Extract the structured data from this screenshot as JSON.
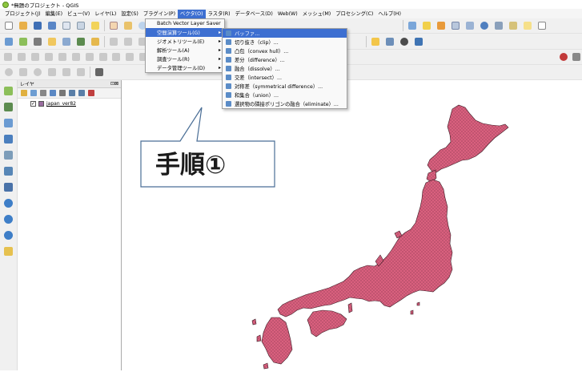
{
  "window": {
    "title": "*無題のプロジェクト - QGIS"
  },
  "menubar": {
    "items": [
      {
        "label": "プロジェクト(J)"
      },
      {
        "label": "編集(E)"
      },
      {
        "label": "ビュー(V)"
      },
      {
        "label": "レイヤ(L)"
      },
      {
        "label": "設定(S)"
      },
      {
        "label": "プラグイン(P)"
      },
      {
        "label": "ベクタ(O)"
      },
      {
        "label": "ラスタ(R)"
      },
      {
        "label": "データベース(D)"
      },
      {
        "label": "Web(W)"
      },
      {
        "label": "メッシュ(M)"
      },
      {
        "label": "プロセシング(C)"
      },
      {
        "label": "ヘルプ(H)"
      }
    ]
  },
  "vector_menu": {
    "items": [
      {
        "label": "Batch Vector Layer Saver",
        "submenu": false
      },
      {
        "label": "空間演算ツール(G)",
        "submenu": true
      },
      {
        "label": "ジオメトリツール(E)",
        "submenu": true
      },
      {
        "label": "解析ツール(A)",
        "submenu": true
      },
      {
        "label": "調査ツール(R)",
        "submenu": true
      },
      {
        "label": "データ管理ツール(D)",
        "submenu": true
      }
    ]
  },
  "geoprocessing_menu": {
    "items": [
      {
        "label": "バッファ..."
      },
      {
        "label": "切り抜き（clip）..."
      },
      {
        "label": "凸包（convex hull）..."
      },
      {
        "label": "差分（difference）..."
      },
      {
        "label": "融合（dissolve）..."
      },
      {
        "label": "交差（intersect）..."
      },
      {
        "label": "対称差（symmetrical difference）..."
      },
      {
        "label": "和集合（union）..."
      },
      {
        "label": "選択物の隣接ポリゴンの融合（eliminate）..."
      }
    ]
  },
  "layers_panel": {
    "title": "レイヤ",
    "close_glyph": "⊡⊠",
    "layers": [
      {
        "name": "japan_ver82",
        "checked": true,
        "check_glyph": "✓",
        "color": "#9a6c9f"
      }
    ]
  },
  "callout": {
    "text": "手順①"
  },
  "colors": {
    "map_fill": "#d9607e",
    "map_stroke": "#3c1a24",
    "menu_highlight": "#3d6fd1"
  }
}
